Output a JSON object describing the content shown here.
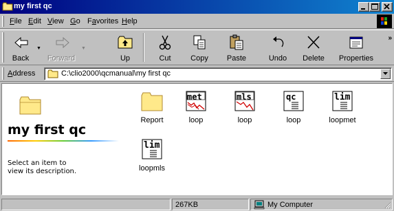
{
  "window": {
    "title": "my first qc"
  },
  "menu": {
    "items": [
      {
        "label": "File",
        "accel": "F"
      },
      {
        "label": "Edit",
        "accel": "E"
      },
      {
        "label": "View",
        "accel": "V"
      },
      {
        "label": "Go",
        "accel": "G"
      },
      {
        "label": "Favorites",
        "accel": "a"
      },
      {
        "label": "Help",
        "accel": "H"
      }
    ]
  },
  "toolbar": {
    "back": "Back",
    "forward": "Forward",
    "up": "Up",
    "cut": "Cut",
    "copy": "Copy",
    "paste": "Paste",
    "undo": "Undo",
    "delete": "Delete",
    "properties": "Properties"
  },
  "address": {
    "label": "Address",
    "value": "C:\\clio2000\\qcmanual\\my first qc"
  },
  "banner": {
    "title": "my first qc",
    "description": "Select an item to\nview its description."
  },
  "files": [
    {
      "name": "Report",
      "type": "folder",
      "tag": ""
    },
    {
      "name": "loop",
      "type": "doc",
      "tag": "met"
    },
    {
      "name": "loop",
      "type": "doc",
      "tag": "mls"
    },
    {
      "name": "loop",
      "type": "doc",
      "tag": "qc"
    },
    {
      "name": "loopmet",
      "type": "doc",
      "tag": "lim"
    },
    {
      "name": "loopmls",
      "type": "doc",
      "tag": "lim"
    }
  ],
  "status": {
    "size": "267KB",
    "zone": "My Computer"
  },
  "colors": {
    "titlebar_start": "#000080",
    "titlebar_end": "#1084d0",
    "face": "#c0c0c0",
    "folder": "#ffe98a"
  }
}
